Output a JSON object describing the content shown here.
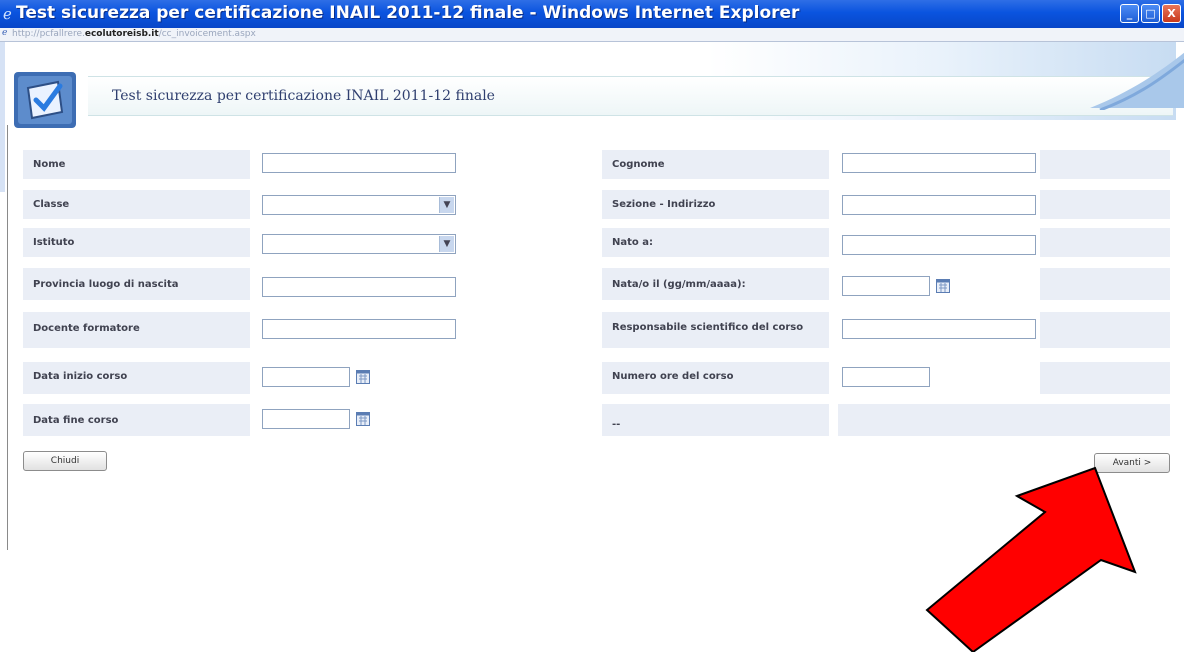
{
  "window": {
    "title": "Test sicurezza per certificazione INAIL 2011-12 finale - Windows Internet Explorer",
    "minimize_glyph": "_",
    "maximize_glyph": "□",
    "close_glyph": "X"
  },
  "address": {
    "prefix": "http://pcfallrere.",
    "domain": "ecolutoreisb.it",
    "suffix": "/cc_invoicement.aspx"
  },
  "header": {
    "title": "Test sicurezza per certificazione INAIL 2011-12 finale"
  },
  "form": {
    "nome": {
      "label": "Nome",
      "value": ""
    },
    "cognome": {
      "label": "Cognome",
      "value": ""
    },
    "classe": {
      "label": "Classe",
      "value": ""
    },
    "sezione": {
      "label": "Sezione - Indirizzo",
      "value": ""
    },
    "istituto": {
      "label": "Istituto",
      "value": ""
    },
    "nato_a": {
      "label": "Nato a:",
      "value": ""
    },
    "provincia": {
      "label": "Provincia luogo di nascita",
      "value": ""
    },
    "nato_il": {
      "label": "Nata/o il (gg/mm/aaaa):",
      "value": ""
    },
    "docente": {
      "label": "Docente formatore",
      "value": ""
    },
    "responsabile": {
      "label": "Responsabile scientifico del corso",
      "value": ""
    },
    "data_inizio": {
      "label": "Data inizio corso",
      "value": ""
    },
    "numero_ore": {
      "label": "Numero ore del corso",
      "value": ""
    },
    "data_fine": {
      "label": "Data fine corso",
      "value": ""
    },
    "placeholder_dash": "--"
  },
  "buttons": {
    "chiudi": "Chiudi",
    "avanti": "Avanti >"
  },
  "annotation": {
    "arrow_color": "#ff0000"
  }
}
